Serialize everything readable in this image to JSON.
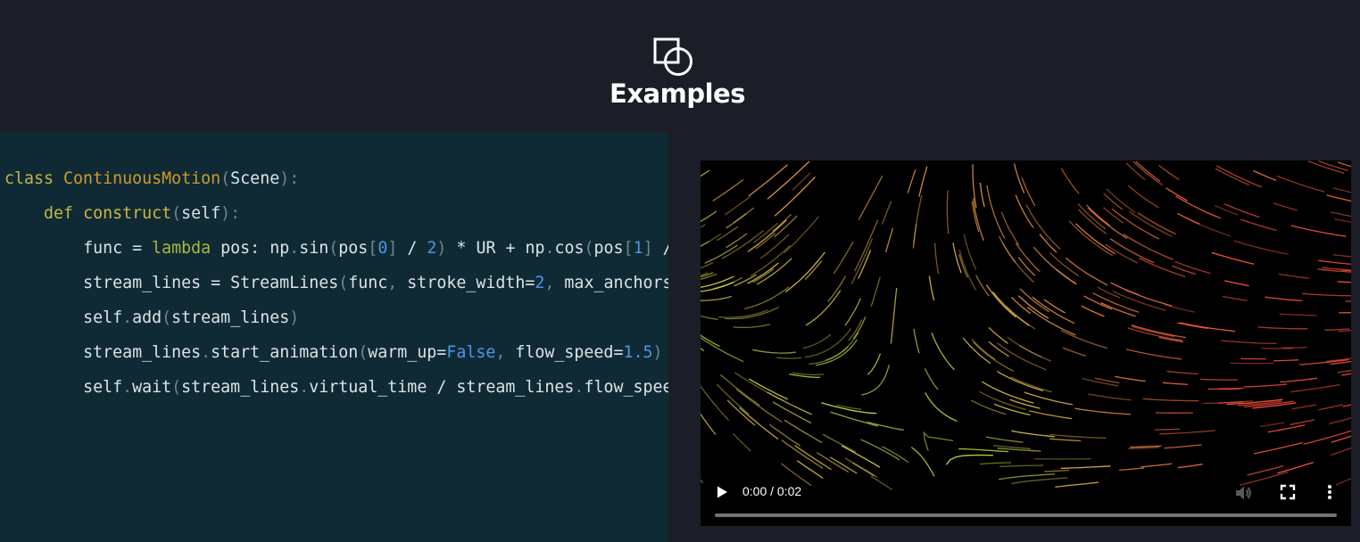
{
  "header": {
    "logo_icon": "shapes-icon",
    "title": "Examples"
  },
  "code": {
    "lines": [
      [
        "class ",
        "ContinuousMotion",
        "(",
        "Scene",
        "):"
      ],
      [
        "def ",
        "construct",
        "(",
        "self",
        "):"
      ],
      [
        "func = ",
        "lambda",
        " pos: np",
        ".",
        "sin",
        "(",
        "pos",
        "[",
        "0",
        "]",
        " / ",
        "2",
        ")",
        " * UR + np",
        ".",
        "cos",
        "(",
        "pos",
        "[",
        "1",
        "]",
        " /"
      ],
      [
        "stream_lines = StreamLines",
        "(",
        "func",
        ",",
        " stroke_width=",
        "2",
        ",",
        " max_anchors"
      ],
      [
        "self",
        ".",
        "add",
        "(",
        "stream_lines",
        ")"
      ],
      [
        "stream_lines",
        ".",
        "start_animation",
        "(",
        "warm_up=",
        "False",
        ",",
        " flow_speed=",
        "1.5",
        ")"
      ],
      [
        "self",
        ".",
        "wait",
        "(",
        "stream_lines",
        ".",
        "virtual_time / stream_lines",
        ".",
        "flow_spee"
      ]
    ]
  },
  "video": {
    "time_display": "0:00 / 0:02",
    "progress": 0.0,
    "play_icon": "play-icon",
    "mute_icon": "volume-icon",
    "fullscreen_icon": "fullscreen-icon",
    "more_icon": "more-vert-icon"
  },
  "colors": {
    "background": "#1b1e27",
    "code_background": "#0f2a35",
    "keyword": "#c4b545",
    "class_name": "#d19a2b",
    "number": "#4f95e4"
  }
}
